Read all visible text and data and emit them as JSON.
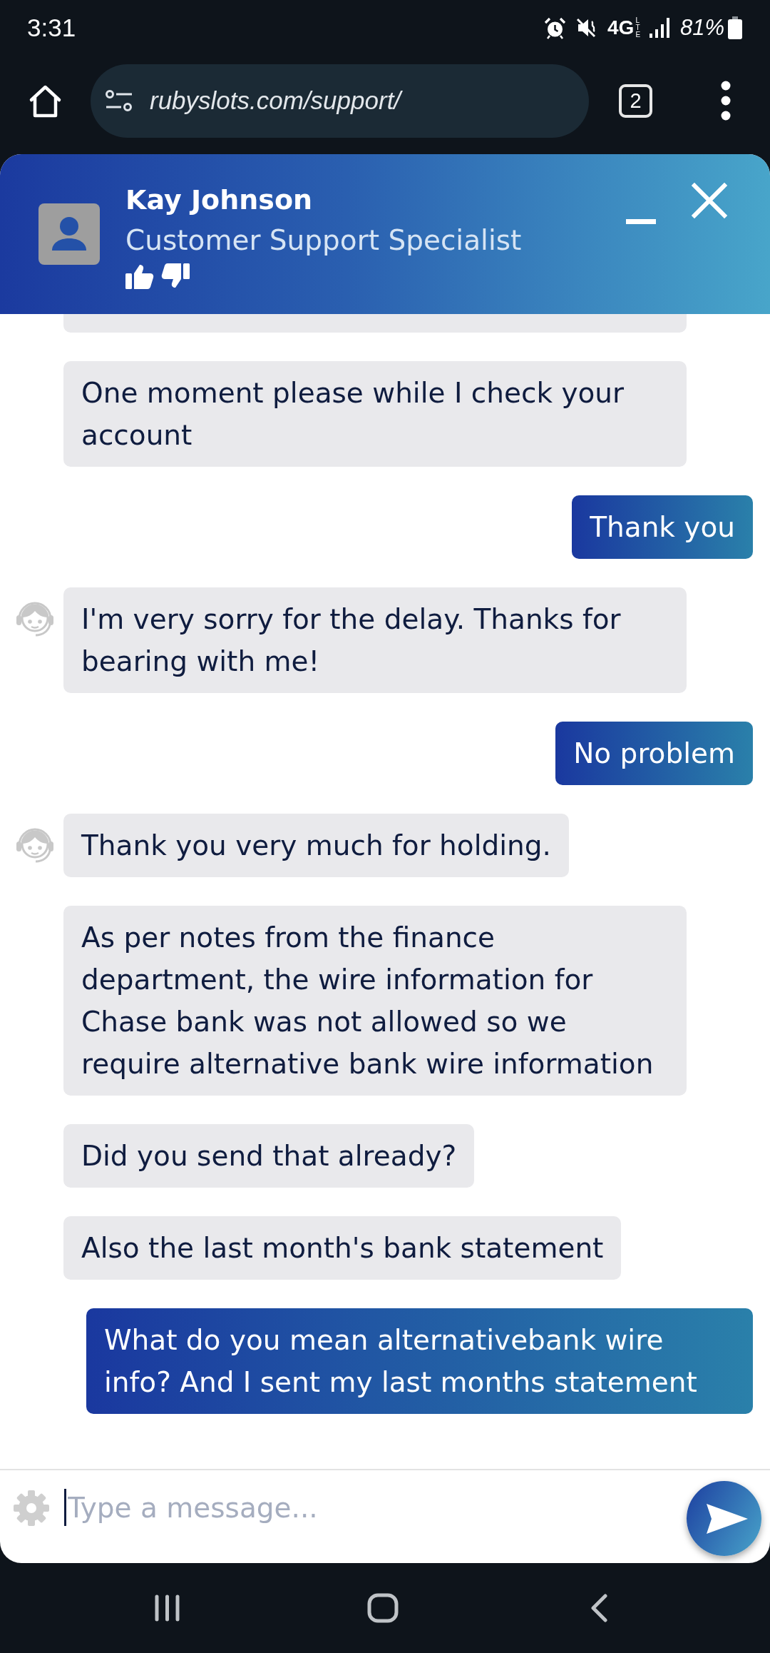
{
  "status_bar": {
    "time": "3:31",
    "network": "4G",
    "network_detail": "LTE",
    "battery": "81%"
  },
  "browser": {
    "url": "rubyslots.com/support/",
    "tab_count": "2"
  },
  "chat_header": {
    "agent_name": "Kay Johnson",
    "agent_title": "Customer Support Specialist"
  },
  "messages": [
    {
      "kind": "agent",
      "avatar": false
    },
    {
      "kind": "agent",
      "avatar": false,
      "text": "One moment please while I check your account"
    },
    {
      "kind": "user",
      "text": "Thank you"
    },
    {
      "kind": "agent",
      "avatar": true,
      "text": "I'm very sorry for the delay. Thanks for bearing with me!"
    },
    {
      "kind": "user",
      "text": "No problem"
    },
    {
      "kind": "agent",
      "avatar": true,
      "text": "Thank you very much for holding."
    },
    {
      "kind": "agent",
      "avatar": false,
      "text": "As per notes from the finance department, the wire information for Chase bank was not allowed so we require alternative bank wire information"
    },
    {
      "kind": "agent",
      "avatar": false,
      "text": "Did you send that already?"
    },
    {
      "kind": "agent",
      "avatar": false,
      "text": "Also the last month's bank statement"
    },
    {
      "kind": "user",
      "text": "What do you mean alternativebank wire info? And I sent my last months statement"
    }
  ],
  "composer": {
    "placeholder": "Type a message...",
    "focused": true
  }
}
